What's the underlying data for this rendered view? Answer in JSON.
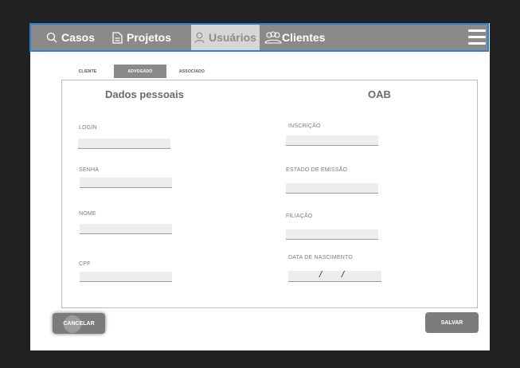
{
  "nav": {
    "items": [
      {
        "label": "Casos",
        "icon": "search-icon"
      },
      {
        "label": "Projetos",
        "icon": "document-icon"
      },
      {
        "label": "Usuários",
        "icon": "user-icon",
        "active": true
      },
      {
        "label": "Clientes",
        "icon": "users-group-icon"
      }
    ],
    "menu_icon": "hamburger-menu-icon"
  },
  "tabs": [
    {
      "label": "CLIENTE"
    },
    {
      "label": "ADVOGADO",
      "active": true
    },
    {
      "label": "ASSOCIADO"
    }
  ],
  "sections": {
    "personal": "Dados pessoais",
    "oab": "OAB"
  },
  "fields": {
    "login": "LOGIN",
    "senha": "SENHA",
    "nome": "NOME",
    "cpf": "CPF",
    "inscricao": "INSCRIÇÃO",
    "estado_emissao": "ESTADO DE EMISSÃO",
    "filiacao": "FILIAÇÃO",
    "data_nascimento": "DATA DE NASCIMENTO"
  },
  "date_separator": "/",
  "buttons": {
    "cancel": "CANCELAR",
    "save": "SALVAR"
  },
  "colors": {
    "navbar": "#8a8a8a",
    "navbar_border": "#2f7fd6",
    "active_tab": "#8a8a8a",
    "button": "#7c7c7c"
  }
}
